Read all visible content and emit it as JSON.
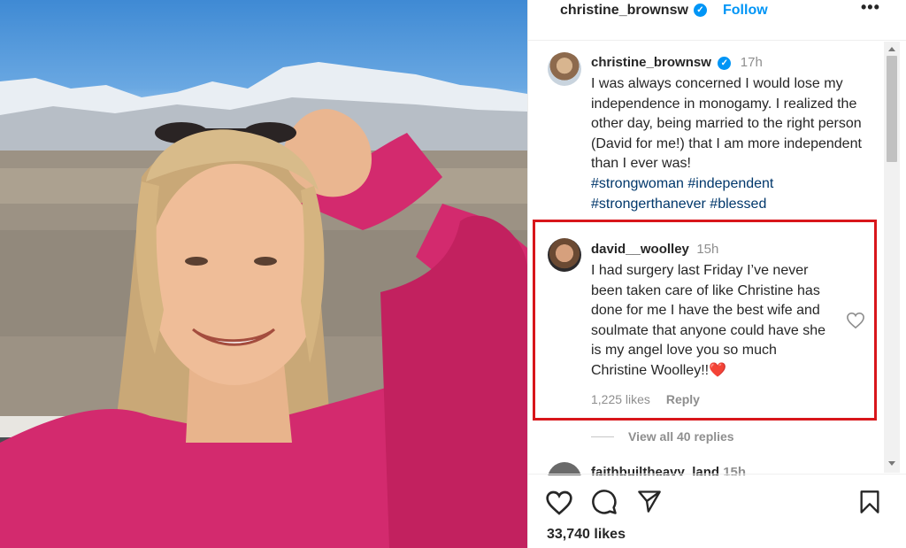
{
  "header": {
    "username": "christine_brownsw",
    "follow_label": "Follow",
    "more_label": "•••"
  },
  "owner_comment": {
    "username": "christine_brownsw",
    "time": "17h",
    "text": "I was always concerned I would lose my independence in monogamy. I realized the other day, being married to the right person (David for me!) that I am more independent than I ever was!",
    "hashtags_line1": "#strongwoman #independent",
    "hashtags_line2": "#strongerthanever #blessed"
  },
  "reply_comment": {
    "username": "david__woolley",
    "time": "15h",
    "text": "I had surgery last Friday I’ve never been taken care of like Christine has done for me I have the best wife and soulmate that anyone could have she is my angel love you so much Christine Woolley!!",
    "emoji": "❤️",
    "likes": "1,225 likes",
    "reply_label": "Reply",
    "highlight_color": "#d8161b"
  },
  "view_replies": "View all 40 replies",
  "third_comment": {
    "username": "faithbuiltheavy_land",
    "time": "15h"
  },
  "footer": {
    "likes_count": "33,740 likes"
  },
  "icons": {
    "verified": "verified-badge-icon",
    "like": "heart-outline-icon",
    "comment": "speech-bubble-icon",
    "share": "paper-plane-icon",
    "save": "bookmark-icon"
  },
  "colors": {
    "link_blue": "#0095f6",
    "hashtag": "#00376b",
    "muted": "#8e8e8e",
    "photo_sweater": "#d32a6e"
  }
}
